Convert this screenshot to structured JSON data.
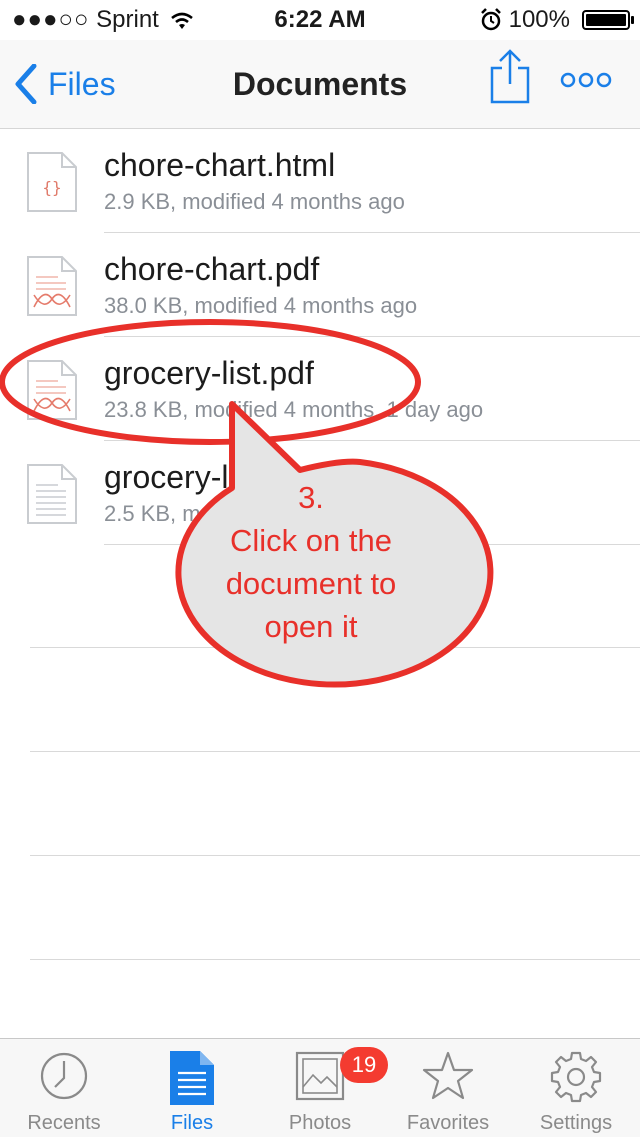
{
  "status_bar": {
    "carrier": "Sprint",
    "signal_dots": "●●●○○",
    "time": "6:22 AM",
    "battery_text": "100%",
    "battery_level": 1.0
  },
  "nav": {
    "back_label": "Files",
    "title": "Documents"
  },
  "files": [
    {
      "name": "chore-chart.html",
      "meta": "2.9 KB, modified 4 months ago",
      "icon": "html-file-icon"
    },
    {
      "name": "chore-chart.pdf",
      "meta": "38.0 KB, modified 4 months ago",
      "icon": "pdf-file-icon"
    },
    {
      "name": "grocery-list.pdf",
      "meta": "23.8 KB, modified 4 months, 1 day ago",
      "icon": "pdf-file-icon"
    },
    {
      "name": "grocery-list.txt",
      "meta": "2.5 KB, modified 4 months ago",
      "icon": "text-file-icon"
    }
  ],
  "callout": {
    "line1": "3.",
    "line2": "Click on the",
    "line3": "document to",
    "line4": "open it",
    "color": "#e8302a"
  },
  "tabs": [
    {
      "label": "Recents",
      "icon": "clock-icon",
      "active": false
    },
    {
      "label": "Files",
      "icon": "document-icon",
      "active": true
    },
    {
      "label": "Photos",
      "icon": "photo-icon",
      "active": false,
      "badge": "19"
    },
    {
      "label": "Favorites",
      "icon": "star-icon",
      "active": false
    },
    {
      "label": "Settings",
      "icon": "gear-icon",
      "active": false
    }
  ],
  "colors": {
    "accent": "#1a7fe8",
    "badge": "#f43b30",
    "annotation": "#e8302a"
  }
}
